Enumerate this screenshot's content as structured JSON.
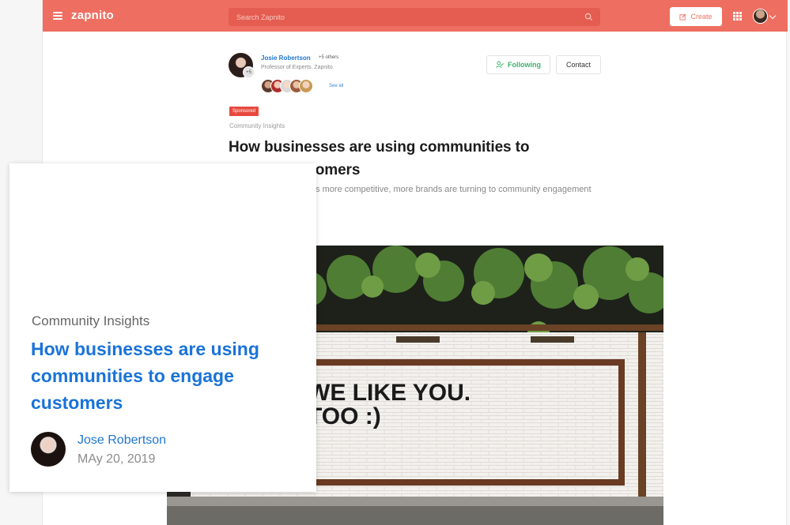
{
  "header": {
    "brand": "zapnito",
    "search_placeholder": "Search Zapnito",
    "create_label": "Create",
    "icons": [
      "menu-icon",
      "search-icon",
      "edit-icon",
      "apps-grid-icon",
      "avatar",
      "chevron-down-icon"
    ]
  },
  "post": {
    "author_name": "Josie Robertson",
    "author_extra": "+5 others",
    "author_role": "Professor of Experts, Zapnito",
    "avatar_badge": "+5",
    "see_all": "See all",
    "following_label": "Following",
    "contact_label": "Contact",
    "sponsored": "Sponsored",
    "category": "Community Insights",
    "title": "How businesses are using communities to engage customers",
    "excerpt": "As the market becomes more competitive, more brands are turning to community engagement to gain an edge."
  },
  "card": {
    "category": "Community Insights",
    "title": "How businesses are using communities to engage customers",
    "author": "Jose Robertson",
    "date": "MAy 20, 2019"
  },
  "photo": {
    "sign_line1": "WE LIKE YOU.",
    "sign_line2": "TOO :)"
  },
  "colors": {
    "brand": "#ee6f61",
    "link": "#1f76d1",
    "following_green": "#3bb36a",
    "sponsored_red": "#e7493f"
  }
}
